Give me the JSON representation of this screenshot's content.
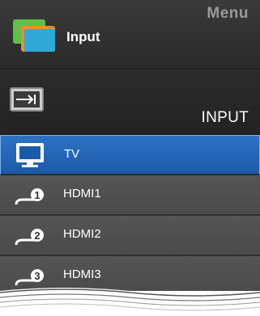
{
  "header": {
    "menu_label": "Menu",
    "title": "Input"
  },
  "source": {
    "label": "INPUT"
  },
  "items": [
    {
      "label": "TV",
      "selected": true
    },
    {
      "label": "HDMI1",
      "number": "1"
    },
    {
      "label": "HDMI2",
      "number": "2"
    },
    {
      "label": "HDMI3",
      "number": "3"
    }
  ],
  "colors": {
    "selected": "#1b5aa8",
    "panel": "#4b4b4b",
    "header": "#2a2a2a"
  }
}
